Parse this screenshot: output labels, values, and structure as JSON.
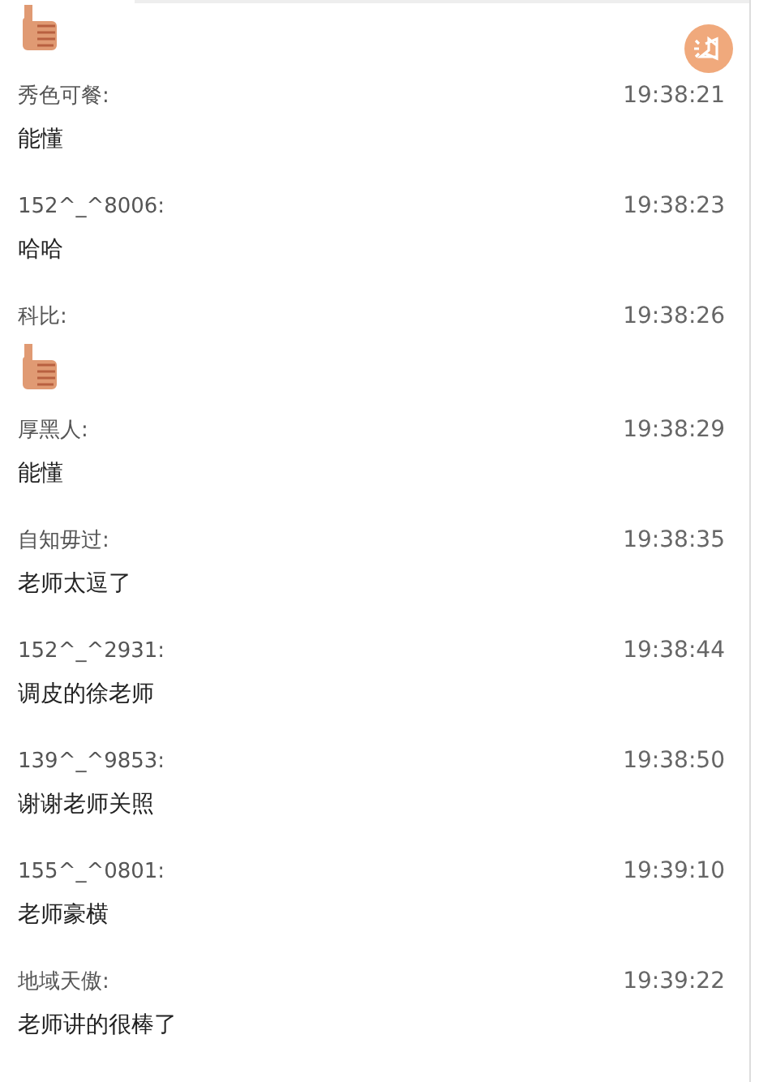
{
  "top_item": {
    "kind": "thumb"
  },
  "messages": [
    {
      "sender": "秀色可餐:",
      "time": "19:38:21",
      "content": {
        "kind": "text",
        "text": "能懂"
      }
    },
    {
      "sender": "152^_^8006:",
      "time": "19:38:23",
      "content": {
        "kind": "text",
        "text": "哈哈"
      }
    },
    {
      "sender": "科比:",
      "time": "19:38:26",
      "content": {
        "kind": "thumb"
      }
    },
    {
      "sender": "厚黑人:",
      "time": "19:38:29",
      "content": {
        "kind": "text",
        "text": "能懂"
      }
    },
    {
      "sender": "自知毋过:",
      "time": "19:38:35",
      "content": {
        "kind": "text",
        "text": "老师太逗了"
      }
    },
    {
      "sender": "152^_^2931:",
      "time": "19:38:44",
      "content": {
        "kind": "text",
        "text": "调皮的徐老师"
      }
    },
    {
      "sender": "139^_^9853:",
      "time": "19:38:50",
      "content": {
        "kind": "text",
        "text": "谢谢老师关照"
      }
    },
    {
      "sender": "155^_^0801:",
      "time": "19:39:10",
      "content": {
        "kind": "text",
        "text": "老师豪横"
      }
    },
    {
      "sender": "地域天傲:",
      "time": "19:39:22",
      "content": {
        "kind": "text",
        "text": "老师讲的很棒了"
      }
    }
  ]
}
